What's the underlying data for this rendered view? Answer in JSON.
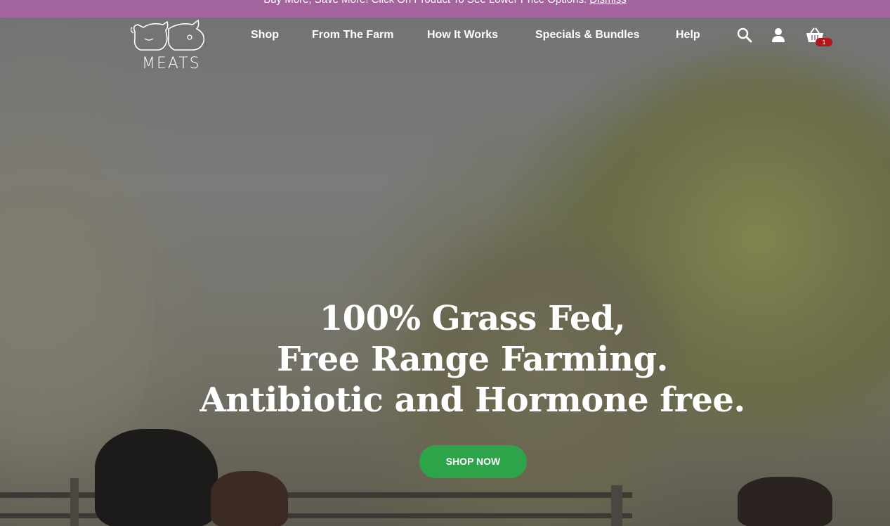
{
  "promo": {
    "text": "Buy More, Save More! Click On Product To See Lower Price Options.",
    "dismiss_label": "Dismiss"
  },
  "brand": {
    "logo_text": "MEATS"
  },
  "nav": {
    "items": [
      {
        "label": "Shop"
      },
      {
        "label": "From The Farm"
      },
      {
        "label": "How It Works"
      },
      {
        "label": "Specials & Bundles"
      },
      {
        "label": "Help"
      }
    ]
  },
  "header_icons": {
    "search": "search-icon",
    "account": "user-icon",
    "cart": "basket-icon",
    "cart_count": "1"
  },
  "hero": {
    "headline_lines": [
      "100% Grass Fed,",
      "Free Range Farming.",
      "Antibiotic and Hormone free."
    ],
    "cta_label": "SHOP NOW"
  },
  "colors": {
    "promo_bg": "#a3639c",
    "cta_bg": "#2ea44a",
    "badge_bg": "#b0171a"
  }
}
